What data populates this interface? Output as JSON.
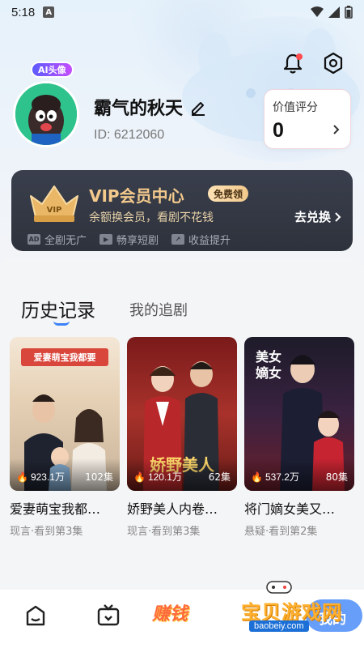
{
  "status_bar": {
    "time": "5:18",
    "notification_letter": "A"
  },
  "header": {
    "bell_icon": "bell-icon",
    "settings_icon": "settings-icon",
    "accent": "#ff4d4f"
  },
  "profile": {
    "ai_badge": "AI头像",
    "username": "霸气的秋天",
    "uid": "ID: 6212060",
    "score_label": "价值评分",
    "score_value": "0"
  },
  "vip": {
    "title": "VIP会员中心",
    "free_badge": "免费领",
    "subtitle": "余额换会员，看剧不花钱",
    "action": "去兑换",
    "perks": [
      {
        "icon": "AD",
        "label": "全剧无广"
      },
      {
        "icon": "▶",
        "label": "畅享短剧"
      },
      {
        "icon": "↗",
        "label": "收益提升"
      }
    ],
    "colors": {
      "gold": "#f3c98c",
      "bg": "#32363f"
    }
  },
  "tabs": {
    "history": "历史记录",
    "following": "我的追剧",
    "active_color": "#3b82f6"
  },
  "history": [
    {
      "title": "爱妻萌宝我都…",
      "views": "923.1万",
      "episodes": "102集",
      "meta": "现言·看到第3集",
      "banner": "爱妻萌宝我都要"
    },
    {
      "title": "娇野美人内卷…",
      "views": "120.1万",
      "episodes": "62集",
      "meta": "现言·看到第3集",
      "banner": "娇野美人"
    },
    {
      "title": "将门嫡女美又…",
      "views": "537.2万",
      "episodes": "80集",
      "meta": "悬疑·看到第2集",
      "banner": "美女嫡女"
    }
  ],
  "nav": {
    "earn_label": "赚钱",
    "mine_label": "我的"
  },
  "watermark": {
    "name": "宝贝游戏网",
    "url": "baobeiy.com"
  }
}
